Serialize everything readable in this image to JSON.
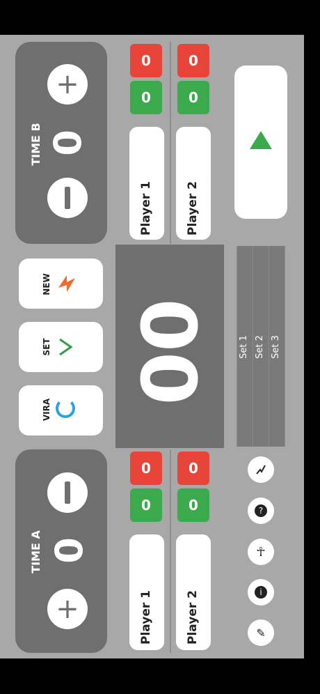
{
  "team_a": {
    "label": "TIME A",
    "score": "0"
  },
  "team_b": {
    "label": "TIME B",
    "score": "0"
  },
  "center_score": "00",
  "actions": {
    "vira": "VIRA",
    "set": "SET",
    "new": "NEW"
  },
  "players_a": [
    {
      "name": "Player 1",
      "green": "0",
      "red": "0"
    },
    {
      "name": "Player 2",
      "green": "0",
      "red": "0"
    }
  ],
  "players_b": [
    {
      "name": "Player 1",
      "green": "0",
      "red": "0"
    },
    {
      "name": "Player 2",
      "green": "0",
      "red": "0"
    }
  ],
  "sets": [
    "Set 1",
    "Set 2",
    "Set 3"
  ],
  "colors": {
    "red": "#e8443a",
    "green": "#3aaa4c",
    "panel": "#6f6f6f",
    "screen": "#a8a8a8"
  },
  "icons": [
    "plus-icon",
    "minus-icon",
    "refresh-icon",
    "check-icon",
    "bolt-icon",
    "play-icon",
    "trend-icon",
    "help-icon",
    "person-icon",
    "info-icon",
    "brush-icon"
  ]
}
